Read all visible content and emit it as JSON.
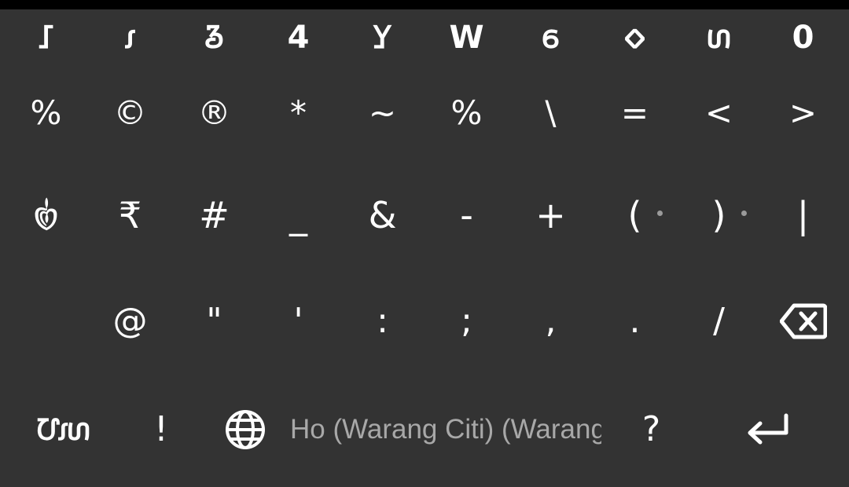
{
  "keyboard": {
    "row1": [
      "𑢡",
      "𑣁",
      "𑢪",
      "4",
      "𑢤",
      "W",
      "𑣕",
      "𑣗",
      "𑣙",
      "0"
    ],
    "row2": [
      "%",
      "©",
      "®",
      "*",
      "~",
      "%",
      "\\",
      "=",
      "<",
      ">"
    ],
    "row3": [
      "𑣿",
      "₹",
      "#",
      "_",
      "&",
      "-",
      "+",
      "(",
      ")",
      "|"
    ],
    "row4": [
      "@",
      "\"",
      "'",
      ":",
      ";",
      ",",
      ".",
      "/"
    ],
    "row5": {
      "script_switch": "𑢹𑣁𑣙",
      "exclaim": "!",
      "space_label": "Ho (Warang Citi) (Warang Citi)",
      "question": "?"
    },
    "icons": {
      "backspace": "backspace-icon",
      "globe": "globe-icon",
      "enter": "enter-icon"
    },
    "colors": {
      "background": "#333333",
      "key_text": "#ffffff",
      "space_text": "#a8a8a8",
      "hint_dot": "#9a9a9a",
      "top_bar": "#000000"
    }
  }
}
